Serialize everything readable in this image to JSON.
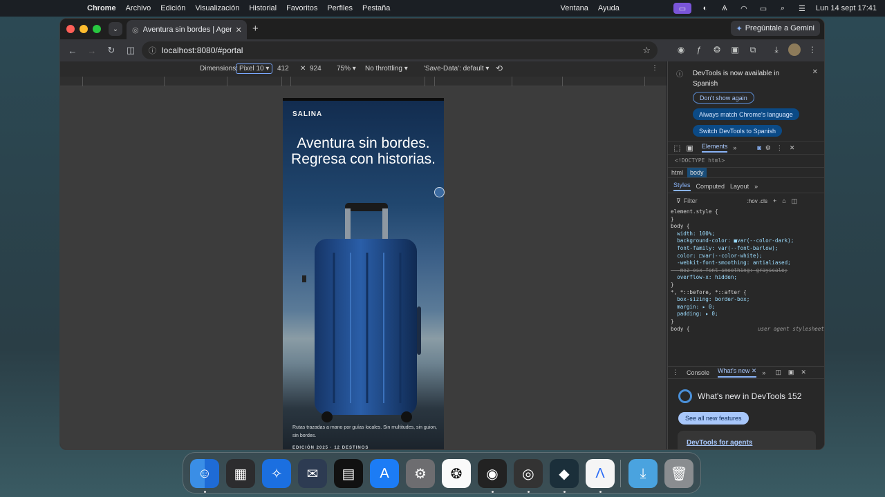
{
  "menubar": {
    "app": "Chrome",
    "items": [
      "Archivo",
      "Edición",
      "Visualización",
      "Historial",
      "Favoritos",
      "Perfiles",
      "Pestaña"
    ],
    "right_items": [
      "Ventana",
      "Ayuda"
    ],
    "datetime": "Lun 14 sept  17:41"
  },
  "browser": {
    "tab_title": "Aventura sin bordes | Agencia",
    "gemini_label": "Pregúntale a Gemini",
    "url": "localhost:8080/#portal"
  },
  "device_toolbar": {
    "dimensions_label": "Dimensions:",
    "device": "Pixel 10",
    "width": "412",
    "height": "924",
    "zoom": "75%",
    "throttling": "No throttling",
    "save_data": "'Save-Data': default"
  },
  "page": {
    "brand": "SALINA",
    "hero_title": "Aventura sin bordes. Regresa con historias.",
    "caption": "Rutas trazadas a mano por guías locales. Sin multitudes, sin guion, sin bordes.",
    "edition": "EDICIÓN 2025 · 12 DESTINOS"
  },
  "devtools": {
    "notice_text": "DevTools is now available in Spanish",
    "btn_dont_show": "Don't show again",
    "btn_match": "Always match Chrome's language",
    "btn_switch": "Switch DevTools to Spanish",
    "panel_tab": "Elements",
    "doctype": "<!DOCTYPE html>",
    "crumb_html": "html",
    "crumb_body": "body",
    "subtabs": [
      "Styles",
      "Computed",
      "Layout"
    ],
    "filter_label": "Filter",
    "filter_tools": ":hov  .cls",
    "code_lines": [
      "element.style {",
      "}",
      "body {",
      "  width: 100%;",
      "  background-color: ■var(--color-dark);",
      "  font-family: var(--font-barlow);",
      "  color: □var(--color-white);",
      "  -webkit-font-smoothing: antialiased;",
      "  -moz-osx-font-smoothing: grayscale;",
      "  overflow-x: hidden;",
      "}",
      "*, *::before, *::after {",
      "  box-sizing: border-box;",
      "  margin: ▸ 0;",
      "  padding: ▸ 0;",
      "}",
      "body {"
    ],
    "ua_label": "user agent stylesheet",
    "drawer_tab_console": "Console",
    "drawer_tab_whatsnew": "What's new",
    "whatsnew_title": "What's new in DevTools 152",
    "see_all": "See all new features",
    "agents_link": "DevTools for agents"
  },
  "colors": {
    "accent_blue": "#8ab4f8",
    "link_blue": "#a8c7fa"
  }
}
